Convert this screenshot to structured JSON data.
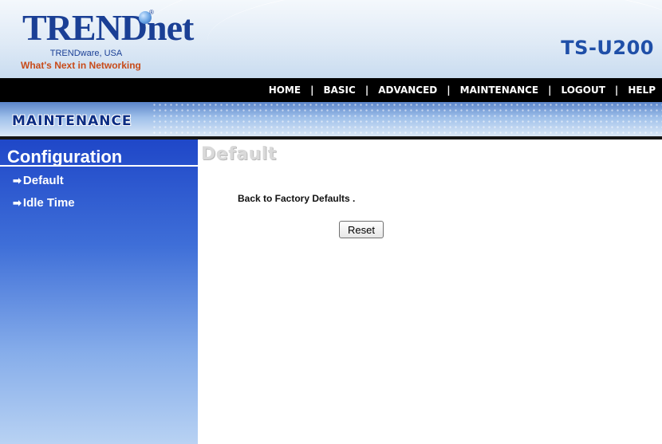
{
  "header": {
    "brand": "TRENDnet",
    "brand_sub": "TRENDware, USA",
    "tagline": "What's Next in Networking",
    "model": "TS-U200"
  },
  "nav": {
    "items": [
      "HOME",
      "BASIC",
      "ADVANCED",
      "MAINTENANCE",
      "LOGOUT",
      "HELP"
    ],
    "separator": "|"
  },
  "section": {
    "title": "MAINTENANCE"
  },
  "sidebar": {
    "heading": "Configuration",
    "items": [
      {
        "label": "Default",
        "icon": "arrow-right-icon"
      },
      {
        "label": "Idle Time",
        "icon": "arrow-right-icon"
      }
    ]
  },
  "main": {
    "title": "Default",
    "message": "Back to Factory Defaults .",
    "reset_label": "Reset"
  },
  "colors": {
    "brand_blue": "#1a3f95",
    "tagline_orange": "#c84b1a",
    "navbar": "#000000",
    "sidebar_top": "#1f47c8"
  }
}
